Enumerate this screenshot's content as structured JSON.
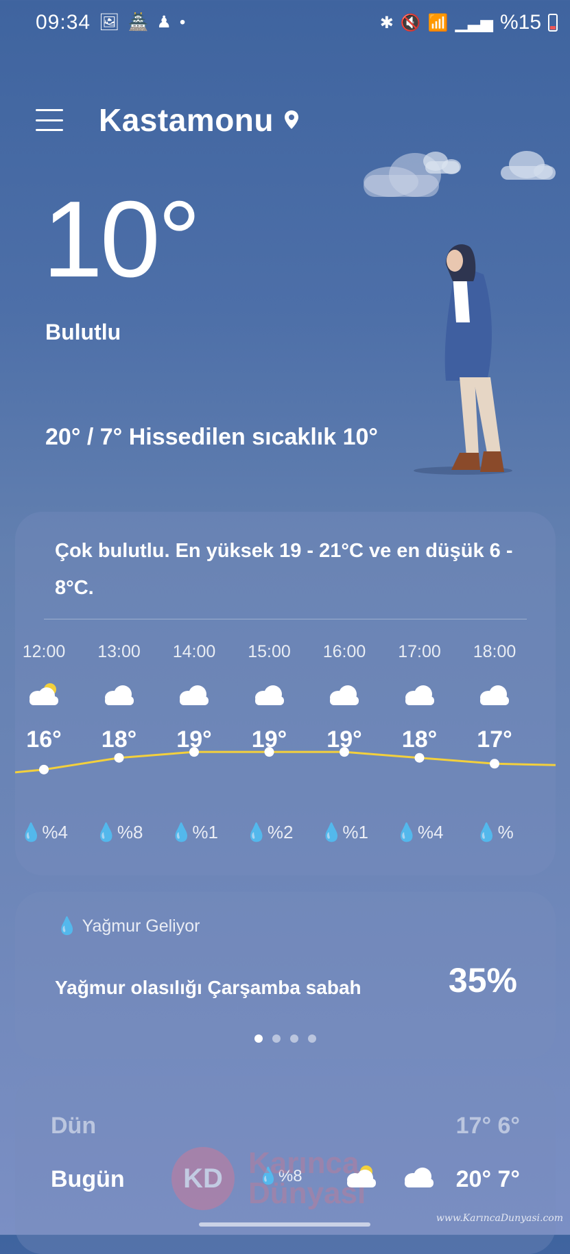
{
  "status": {
    "time": "09:34",
    "battery": "%15"
  },
  "location": {
    "city": "Kastamonu"
  },
  "current": {
    "temp": "10°",
    "condition": "Bulutlu",
    "hilo": "20° / 7°",
    "feels_like": "Hissedilen sıcaklık 10°"
  },
  "forecast": {
    "summary": "Çok bulutlu. En yüksek 19 - 21°C ve en düşük 6 - 8°C.",
    "hours": [
      {
        "time": "12:00",
        "temp": "16°",
        "rain": "%4",
        "icon": "partly-cloudy-icon"
      },
      {
        "time": "13:00",
        "temp": "18°",
        "rain": "%8",
        "icon": "cloud-icon"
      },
      {
        "time": "14:00",
        "temp": "19°",
        "rain": "%1",
        "icon": "cloud-icon"
      },
      {
        "time": "15:00",
        "temp": "19°",
        "rain": "%2",
        "icon": "cloud-icon"
      },
      {
        "time": "16:00",
        "temp": "19°",
        "rain": "%1",
        "icon": "cloud-icon"
      },
      {
        "time": "17:00",
        "temp": "18°",
        "rain": "%4",
        "icon": "cloud-icon"
      },
      {
        "time": "18:00",
        "temp": "17°",
        "rain": "%",
        "icon": "cloud-icon"
      }
    ]
  },
  "rain_card": {
    "title": "Yağmur Geliyor",
    "text": "Yağmur olasılığı Çarşamba sabah",
    "percent": "35%",
    "page_count": 4,
    "active_page": 1
  },
  "daily": {
    "yesterday": {
      "label": "Dün",
      "temps": "17° 6°"
    },
    "today": {
      "label": "Bugün",
      "rain": "%8",
      "temps": "20° 7°"
    }
  },
  "watermark": {
    "logo": "KD",
    "text_line1": "Karınca",
    "text_line2": "Dünyası",
    "url": "www.KarıncaDunyasi.com"
  },
  "colors": {
    "accent_curve": "#f3d03c",
    "background_top": "#3f649f",
    "background_bottom": "#7b8fc4"
  }
}
